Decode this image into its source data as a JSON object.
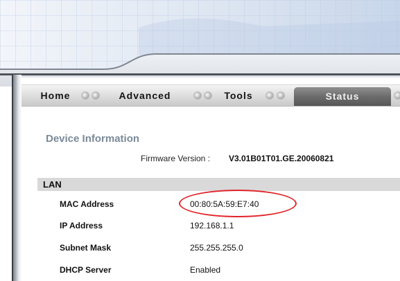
{
  "nav": {
    "tabs": [
      {
        "label": "Home",
        "active": false
      },
      {
        "label": "Advanced",
        "active": false
      },
      {
        "label": "Tools",
        "active": false
      },
      {
        "label": "Status",
        "active": true
      }
    ]
  },
  "device_info": {
    "title": "Device Information",
    "firmware_label": "Firmware Version :",
    "firmware_value": "V3.01B01T01.GE.20060821"
  },
  "lan": {
    "header": "LAN",
    "rows": [
      {
        "label": "MAC Address",
        "value": "00:80:5A:59:E7:40"
      },
      {
        "label": "IP Address",
        "value": "192.168.1.1"
      },
      {
        "label": "Subnet Mask",
        "value": "255.255.255.0"
      },
      {
        "label": "DHCP Server",
        "value": "Enabled"
      }
    ]
  },
  "colors": {
    "highlight": "#e0242a",
    "section_title": "#7b8a99",
    "active_tab": "#6c6c6c"
  }
}
